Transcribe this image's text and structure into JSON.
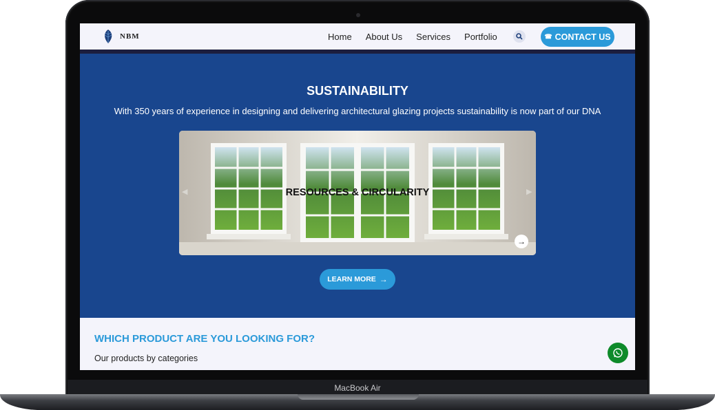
{
  "device": {
    "label": "MacBook Air"
  },
  "navbar": {
    "logo_text": "NBM",
    "links": [
      "Home",
      "About Us",
      "Services",
      "Portfolio"
    ],
    "search_icon": "search-icon",
    "contact_label": "CONTACT US",
    "accent_color": "#2b9ad9"
  },
  "hero": {
    "title": "SUSTAINABILITY",
    "subtitle": "With 350 years of experience in designing and delivering architectural glazing projects sustainability is now part of our DNA",
    "background_color": "#19468e",
    "slide": {
      "caption": "RESOURCES & CIRCULARITY"
    },
    "learn_more_label": "LEARN MORE"
  },
  "products": {
    "title": "WHICH PRODUCT ARE YOU LOOKING FOR?",
    "subtitle": "Our products by categories"
  },
  "floating": {
    "whatsapp_icon": "whatsapp-icon",
    "color": "#0e8a2a"
  }
}
